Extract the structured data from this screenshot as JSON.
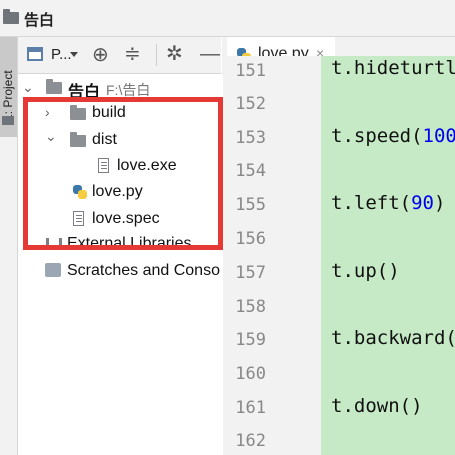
{
  "window": {
    "title": "告白"
  },
  "tool_strip": {
    "project_label": "1: Project"
  },
  "project_toolbar": {
    "view_label": "P..."
  },
  "editor_tab": {
    "label": "love.py",
    "close": "×"
  },
  "tree": {
    "root": {
      "name": "告白",
      "path": "F:\\告白"
    },
    "items": [
      {
        "label": "build"
      },
      {
        "label": "dist"
      },
      {
        "label": "love.exe"
      },
      {
        "label": "love.py"
      },
      {
        "label": "love.spec"
      },
      {
        "label": "External Libraries"
      },
      {
        "label": "Scratches and Consoles"
      }
    ]
  },
  "gutter": {
    "lines": [
      "151",
      "152",
      "153",
      "154",
      "155",
      "156",
      "157",
      "158",
      "159",
      "160",
      "161",
      "162"
    ]
  },
  "code": {
    "line151": "t.hideturtle()",
    "line153_prefix": "t.speed(",
    "line153_num": "100",
    "line155_prefix": "t.left(",
    "line155_num": "90",
    "line155_suffix": ")",
    "line157": "t.up()",
    "line159": "t.backward(",
    "line161": "t.down()"
  },
  "colors": {
    "highlight": "#e53935",
    "code_background": "#c6eac6",
    "number": "#0000ee",
    "tab_underline": "#4a88c7"
  }
}
